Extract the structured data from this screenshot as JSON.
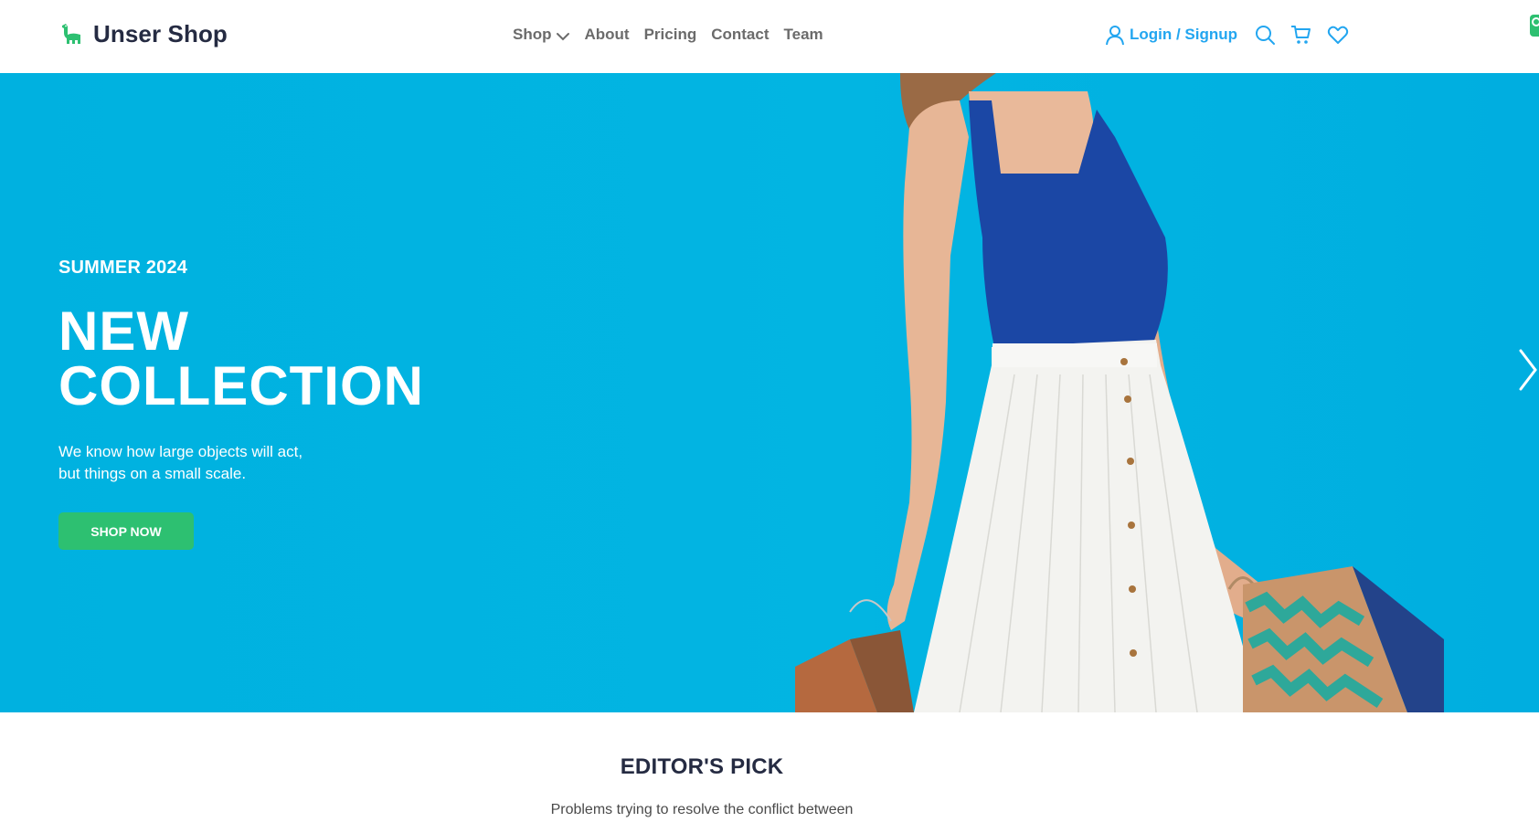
{
  "header": {
    "brand_name": "Unser Shop",
    "logo_icon": "dinosaur-icon",
    "nav": [
      {
        "label": "Shop",
        "has_dropdown": true
      },
      {
        "label": "About"
      },
      {
        "label": "Pricing"
      },
      {
        "label": "Contact"
      },
      {
        "label": "Team"
      }
    ],
    "login_label": "Login / Signup",
    "icons": [
      "user-icon",
      "search-icon",
      "cart-icon",
      "heart-icon"
    ]
  },
  "hero": {
    "eyebrow": "SUMMER 2024",
    "title_line1": "NEW",
    "title_line2": "COLLECTION",
    "desc_line1": "We know how large objects will act,",
    "desc_line2": "but things on a small scale.",
    "cta_label": "SHOP NOW",
    "next_icon": "chevron-right-icon"
  },
  "editors_pick": {
    "title": "EDITOR'S PICK",
    "subtitle": "Problems trying to resolve the conflict between"
  },
  "colors": {
    "accent": "#23a6f0",
    "hero_bg": "#00b1e0",
    "cta_green": "#2dc071",
    "heading": "#252b42",
    "nav_text": "#6b6b6b"
  }
}
